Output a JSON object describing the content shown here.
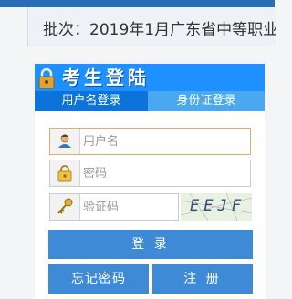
{
  "header": {
    "batch_text": "批次：2019年1月广东省中等职业"
  },
  "login": {
    "title": "考生登陆",
    "tabs": [
      {
        "label": "用户名登录",
        "active": true
      },
      {
        "label": "身份证登录",
        "active": false
      }
    ],
    "username": {
      "placeholder": "用户名",
      "value": ""
    },
    "password": {
      "placeholder": "密码",
      "value": ""
    },
    "captcha_input": {
      "placeholder": "验证码",
      "value": ""
    },
    "captcha_image_text": "EEJF",
    "login_button": "登 录",
    "forgot_button": "忘记密码",
    "register_button": "注 册"
  },
  "colors": {
    "header_blue": "#1e90ff",
    "tab_active": "#0b73d9",
    "tab_inactive": "#4aa8f0",
    "button_blue": "#3f8ad6"
  },
  "icons": {
    "header": "lock-icon",
    "username": "user-icon",
    "password": "padlock-icon",
    "captcha": "key-icon"
  }
}
